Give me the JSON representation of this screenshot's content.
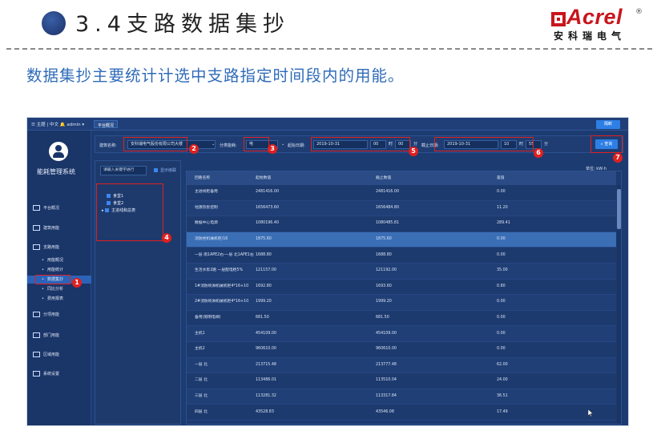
{
  "header": {
    "title": "3.4支路数据集抄",
    "logo_text": "Acrel",
    "logo_reg": "®",
    "logo_cn": "安科瑞电气",
    "subtitle": "数据集抄主要统计计选中支路指定时间段内的用能。"
  },
  "app": {
    "topbar": {
      "user": "☰ 主题 | 中文 🔔 admin ▾",
      "tab": "平台概况",
      "right_button": "隔断"
    },
    "sidebar": {
      "system_name": "能耗管理系统",
      "items": [
        {
          "label": "平台概况",
          "icon": "monitor-icon",
          "sub": false
        },
        {
          "label": "建筑用能",
          "icon": "building-icon",
          "sub": false
        },
        {
          "label": "支路用能",
          "icon": "branch-icon",
          "sub": false
        },
        {
          "label": "用能概况",
          "sub": true
        },
        {
          "label": "用能统计",
          "sub": true
        },
        {
          "label": "数据集抄",
          "sub": true,
          "active": true
        },
        {
          "label": "同比分析",
          "sub": true
        },
        {
          "label": "费用报表",
          "sub": true
        },
        {
          "label": "分项用能",
          "icon": "pie-icon",
          "sub": false
        },
        {
          "label": "部门用能",
          "icon": "folder-icon",
          "sub": false
        },
        {
          "label": "区域用能",
          "icon": "grid-icon",
          "sub": false
        },
        {
          "label": "系统设置",
          "icon": "settings-icon",
          "sub": false
        }
      ]
    },
    "filters": {
      "building_label": "建筑名称:",
      "building_value": "安科瑞电气股份有限公司大楼",
      "category_label": "分类能耗:",
      "category_value": "电",
      "start_label": "起始日期:",
      "start_date": "2019-10-31",
      "start_hour": "00",
      "start_min": "00",
      "hour_unit": "时",
      "min_unit": "分",
      "end_label": "截止日期:",
      "end_date": "2019-10-31",
      "end_hour": "10",
      "end_min": "55",
      "search_button": "查询"
    },
    "tree": {
      "search_placeholder": "请输入关键字进行",
      "check_label": "显示级联",
      "items": [
        "食堂1",
        "食堂2",
        "主进线和总表"
      ]
    },
    "unit_label": "单位: kW·h",
    "table": {
      "headers": [
        "回路名称",
        "起始数值",
        "截止数值",
        "差值"
      ],
      "rows": [
        [
          "主进线柜备用",
          "2481416.00",
          "2481416.00",
          "0.00"
        ],
        [
          "地源热泵控制",
          "1656473.60",
          "1656484.80",
          "11.20"
        ],
        [
          "数据中心电源",
          "1080196.40",
          "1080485.81",
          "289.41"
        ],
        [
          "消防栓机械机柜/16",
          "1875.60",
          "1875.60",
          "0.00"
        ],
        [
          "一层 南1APE2右-一层 北1APE1右",
          "1688.80",
          "1688.80",
          "0.00"
        ],
        [
          "生活水泵2路 一层配电柜5%",
          "121157.00",
          "121192.00",
          "35.00"
        ],
        [
          "1#消防喷淋机械机柜4*16+10",
          "1692.80",
          "1693.60",
          "0.80"
        ],
        [
          "2#消防喷淋机械机柜4*16+10",
          "1999.20",
          "1999.20",
          "0.00"
        ],
        [
          "备用(照明电梯)",
          "681.50",
          "681.50",
          "0.00"
        ],
        [
          "主机1",
          "454109.00",
          "454109.00",
          "0.00"
        ],
        [
          "主机2",
          "960610.00",
          "960610.00",
          "0.00"
        ],
        [
          "一层 北",
          "213715.48",
          "213777.48",
          "62.00"
        ],
        [
          "二层 北",
          "113486.01",
          "113510.04",
          "24.00"
        ],
        [
          "三层 北",
          "113281.32",
          "113317.84",
          "36.51"
        ],
        [
          "四层 北",
          "43528.83",
          "43546.08",
          "17.49"
        ]
      ]
    },
    "badges": [
      "1",
      "2",
      "3",
      "4",
      "5",
      "6",
      "7"
    ],
    "colors": {
      "accent": "#2d7fe6",
      "highlight": "#e02020",
      "sidebar": "#1a3568",
      "subtitle": "#2f6bb8",
      "logo": "#c8161d"
    }
  }
}
